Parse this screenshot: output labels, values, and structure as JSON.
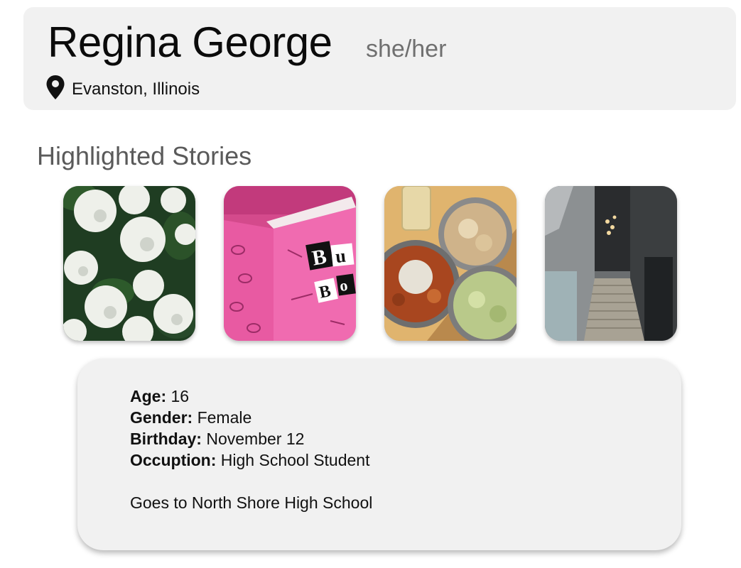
{
  "profile": {
    "name": "Regina George",
    "pronouns": "she/her",
    "location": "Evanston, Illinois",
    "location_icon": "map-pin-icon"
  },
  "stories": {
    "title": "Highlighted Stories",
    "items": [
      {
        "subject": "white-hydrangeas"
      },
      {
        "subject": "pink-burn-book",
        "visible_text": "Bu Bo"
      },
      {
        "subject": "pasta-dinner"
      },
      {
        "subject": "outdoor-staircase"
      }
    ]
  },
  "details": {
    "age_label": "Age:",
    "age_value": "16",
    "gender_label": "Gender:",
    "gender_value": "Female",
    "birthday_label": "Birthday:",
    "birthday_value": "November 12",
    "occupation_label": "Occuption:",
    "occupation_value": "High School Student",
    "note": "Goes to North Shore High School"
  },
  "colors": {
    "card_background": "#f1f1f1",
    "pronouns_text": "#707070",
    "section_title_text": "#5a5a5a",
    "burn_book_pink": "#e8509b"
  }
}
